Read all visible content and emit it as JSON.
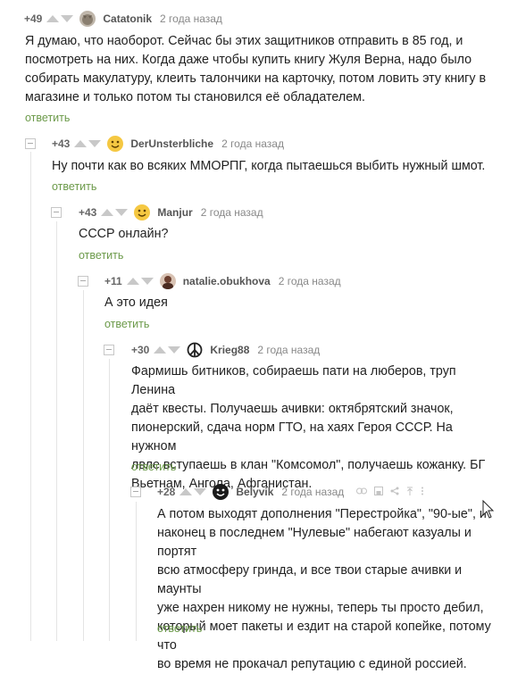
{
  "comments": [
    {
      "rating": "+49",
      "user": "Catatonik",
      "time": "2 года назад",
      "avatar": "cat-avatar-icon",
      "lines": [
        "Я думаю, что наоборот. Сейчас бы этих защитников отправить в 85 год, и",
        "посмотреть на них. Когда даже чтобы купить книгу Жуля Верна, надо было",
        "собирать макулатуру, клеить талончики на карточку, потом ловить эту книгу в",
        "магазине и только потом ты становился её обладателем."
      ],
      "reply": "ответить"
    },
    {
      "rating": "+43",
      "user": "DerUnsterbliche",
      "time": "2 года назад",
      "avatar": "smiley-yellow-avatar-icon",
      "lines": [
        "Ну почти как во всяких ММОРПГ, когда пытаешься выбить нужный шмот."
      ],
      "reply": "ответить"
    },
    {
      "rating": "+43",
      "user": "Manjur",
      "time": "2 года назад",
      "avatar": "smiley-yellow-avatar-icon",
      "lines": [
        "СССР онлайн?"
      ],
      "reply": "ответить"
    },
    {
      "rating": "+11",
      "user": "natalie.obukhova",
      "time": "2 года назад",
      "avatar": "person-avatar-icon",
      "lines": [
        "А это идея"
      ],
      "reply": "ответить"
    },
    {
      "rating": "+30",
      "user": "Krieg88",
      "time": "2 года назад",
      "avatar": "peace-sign-avatar-icon",
      "lines": [
        "Фармишь битников, собираешь пати на люберов, труп Ленина",
        "даёт квесты. Получаешь ачивки: октябрятский значок,",
        "пионерский, сдача норм ГТО, на хаях Героя СССР. На нужном",
        "лвле вступаешь в клан \"Комсомол\", получаешь кожанку. БГ",
        "Вьетнам, Ангола, Афганистан."
      ],
      "reply": "ответить"
    },
    {
      "rating": "+28",
      "user": "Belyvik",
      "time": "2 года назад",
      "avatar": "smiley-black-avatar-icon",
      "lines": [
        "А потом выходят дополнения \"Перестройка\", \"90-ые\", и",
        "наконец в последнем \"Нулевые\" набегают казуалы и портят",
        "всю атмосферу гринда, и все твои старые ачивки и маунты",
        "уже нахрен никому не нужны, теперь ты просто дебил,",
        "который моет пакеты и ездит на старой копейке, потому что",
        "во время не прокачал репутацию с единой россией."
      ],
      "reply": "ответить"
    }
  ],
  "colors": {
    "reply_link": "#6c9a4a",
    "rating": "#666666",
    "time": "#888888"
  }
}
